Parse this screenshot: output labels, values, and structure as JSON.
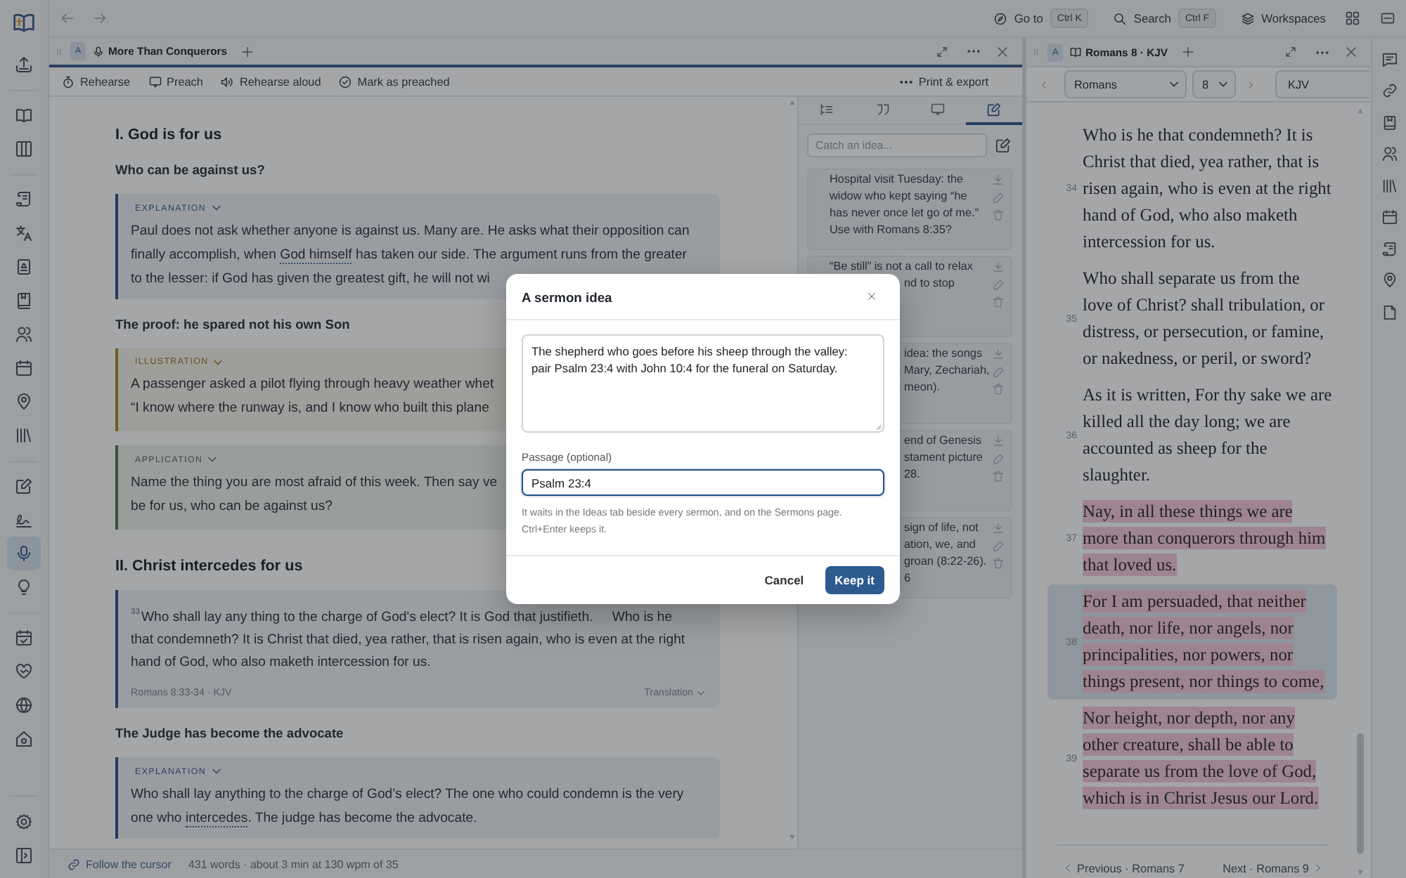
{
  "top_bar": {
    "go_to": {
      "label": "Go to",
      "shortcut": "Ctrl K"
    },
    "search": {
      "label": "Search",
      "shortcut": "Ctrl F"
    },
    "workspaces": "Workspaces"
  },
  "left_rail": {
    "groups": [
      {
        "items": [
          {
            "selected": false
          },
          {
            "selected": false
          }
        ]
      },
      {
        "items": [
          {
            "selected": false
          },
          {
            "selected": false
          },
          {
            "selected": false
          },
          {
            "selected": false
          },
          {
            "selected": false
          },
          {
            "selected": false
          },
          {
            "selected": false
          },
          {
            "selected": false
          }
        ]
      },
      {
        "items": [
          {
            "selected": false
          },
          {
            "selected": false
          },
          {
            "selected": true
          },
          {
            "selected": false
          }
        ]
      },
      {
        "items": [
          {
            "selected": false
          },
          {
            "selected": false
          },
          {
            "selected": false
          },
          {
            "selected": false
          }
        ]
      }
    ]
  },
  "sermon_pane": {
    "tab": {
      "label": "A",
      "title": "More Than Conquerors",
      "focused": true
    },
    "toolbar": {
      "actions": [
        "Rehearse",
        "Preach",
        "Rehearse aloud",
        "Mark as preached"
      ],
      "menu": "Print & export"
    },
    "document": {
      "blocks": [
        {
          "kind": "heading",
          "text": "I. God is for us"
        },
        {
          "kind": "subheading",
          "text": "Who can be against us?"
        },
        {
          "kind": "explanation",
          "label": "EXPLANATION",
          "parts": [
            {
              "kind": "text",
              "text": "Paul does not ask whether anyone is against us. Many are. He asks what their opposition can finally accomplish, when "
            },
            {
              "kind": "term",
              "text": "God himself"
            },
            {
              "kind": "text",
              "text": " has taken our side. The argument runs from the greater to the lesser: if God has given the greatest gift, he will not wi"
            }
          ]
        },
        {
          "kind": "subheading",
          "text": "The proof: he spared not his own Son"
        },
        {
          "kind": "illustration",
          "label": "ILLUSTRATION",
          "parts": [
            {
              "kind": "text",
              "text": "A passenger asked a pilot flying through heavy weather whet “I know where the runway is, and I know who built this plane"
            }
          ]
        },
        {
          "kind": "application",
          "label": "APPLICATION",
          "parts": [
            {
              "kind": "text",
              "text": "Name the thing you are most afraid of this week. Then say ve be for us, who can be against us?"
            }
          ]
        },
        {
          "kind": "heading",
          "text": "II. Christ intercedes for us"
        },
        {
          "kind": "scripture",
          "verses": [
            {
              "number": "33",
              "text": "Who shall lay any thing to the charge of God's elect? It is God that justifieth."
            },
            {
              "text": "Who is he that condemneth? It is Christ that died, yea rather, that is risen again, who is even at the right hand of God, who also maketh intercession for us."
            }
          ],
          "reference": "Romans 8:33-34 · KJV",
          "translation": "Translation"
        },
        {
          "kind": "subheading",
          "text": "The Judge has become the advocate"
        },
        {
          "kind": "explanation",
          "label": "EXPLANATION",
          "parts": [
            {
              "kind": "text",
              "text": "Who shall lay anything to the charge of God’s elect? The one who could condemn is the very one who "
            },
            {
              "kind": "term",
              "text": "intercedes"
            },
            {
              "kind": "text",
              "text": ". The judge has become the advocate."
            }
          ]
        }
      ]
    },
    "status_bar": {
      "follow": "Follow the cursor",
      "stats": "431 words · about 3 min at 130 wpm of 35"
    }
  },
  "ideas_panel": {
    "tabs": [
      {
        "selected": false
      },
      {
        "selected": false
      },
      {
        "selected": false
      },
      {
        "selected": true
      }
    ],
    "placeholder": "Catch an idea...",
    "ideas": [
      {
        "text": "Hospital visit Tuesday: the widow who kept saying “he has never once let go of me.” Use with Romans 8:35?"
      },
      {
        "text": "“Be still” is not a call to relax nd to stop"
      },
      {
        "text": "idea: the songs Mary, Zechariah, meon)."
      },
      {
        "text": "end of Genesis stament picture 28."
      },
      {
        "text": "sign of life, not ation, we, and groan (8:22-26). 6"
      }
    ]
  },
  "bible_pane": {
    "tab": {
      "label": "A",
      "title": "Romans 8 · KJV",
      "focused": false
    },
    "book": "Romans",
    "chapter": "8",
    "version": "KJV",
    "verses": [
      {
        "number": "34",
        "text": "Who is he that condemneth? It is Christ that died, yea rather, that is risen again, who is even at the right hand of God, who also maketh intercession for us.",
        "highlighted": false,
        "selected": false
      },
      {
        "number": "35",
        "text": "Who shall separate us from the love of Christ? shall tribulation, or distress, or persecution, or famine, or nakedness, or peril, or sword?",
        "highlighted": false,
        "selected": false
      },
      {
        "number": "36",
        "text": "As it is written, For thy sake we are killed all the day long; we are accounted as sheep for the slaughter.",
        "highlighted": false,
        "selected": false
      },
      {
        "number": "37",
        "text": "Nay, in all these things we are more than conquerors through him that loved us.",
        "highlighted": true,
        "selected": false
      },
      {
        "number": "38",
        "text": "For I am persuaded, that neither death, nor life, nor angels, nor principalities, nor powers, nor things present, nor things to come,",
        "highlighted": true,
        "selected": true
      },
      {
        "number": "39",
        "text": "Nor height, nor depth, nor any other creature, shall be able to separate us from the love of God, which is in Christ Jesus our Lord.",
        "highlighted": true,
        "selected": false
      }
    ],
    "previous": "Previous · Romans 7",
    "next": "Next · Romans 9"
  },
  "dialog": {
    "title": "A sermon idea",
    "idea": "The shepherd who goes before his sheep through the valley: pair Psalm 23:4 with John 10:4 for the funeral on Saturday.",
    "passage_label": "Passage (optional)",
    "passage": "Psalm 23:4",
    "hint": "It waits in the Ideas tab beside every sermon, and on the Sermons page. Ctrl+Enter keeps it.",
    "buttons": [
      {
        "label": "Cancel",
        "kind": "secondary"
      },
      {
        "label": "Keep it",
        "kind": "primary"
      }
    ]
  }
}
